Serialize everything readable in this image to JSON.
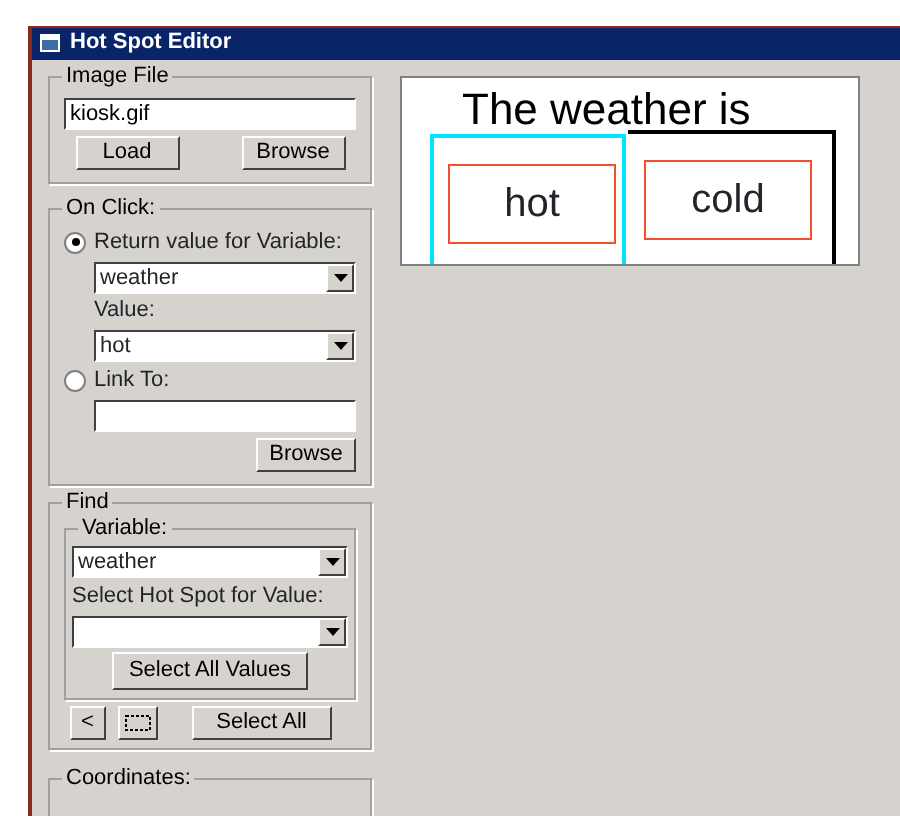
{
  "window": {
    "title": "Hot Spot Editor"
  },
  "image_file": {
    "label": "Image File",
    "value": "kiosk.gif",
    "buttons": [
      "Load",
      "Browse"
    ]
  },
  "on_click": {
    "label": "On Click:",
    "options": [
      {
        "label": "Return value for Variable:",
        "selected": true
      },
      {
        "label": "Link To:",
        "selected": false
      }
    ],
    "variable": "weather",
    "value_label": "Value:",
    "value": "hot",
    "browse": "Browse"
  },
  "find": {
    "label": "Find",
    "variable_group": "Variable:",
    "variable": "weather",
    "spot_label": "Select Hot Spot for Value:",
    "select_values": "Select All Values"
  },
  "nav": {
    "prev": "<",
    "select_all": "Select All"
  },
  "coordinates": {
    "label": "Coordinates:"
  },
  "canvas": {
    "heading": "The weather is",
    "hotspots": [
      {
        "label": "hot",
        "selected": true
      },
      {
        "label": "cold",
        "selected": false
      }
    ]
  }
}
